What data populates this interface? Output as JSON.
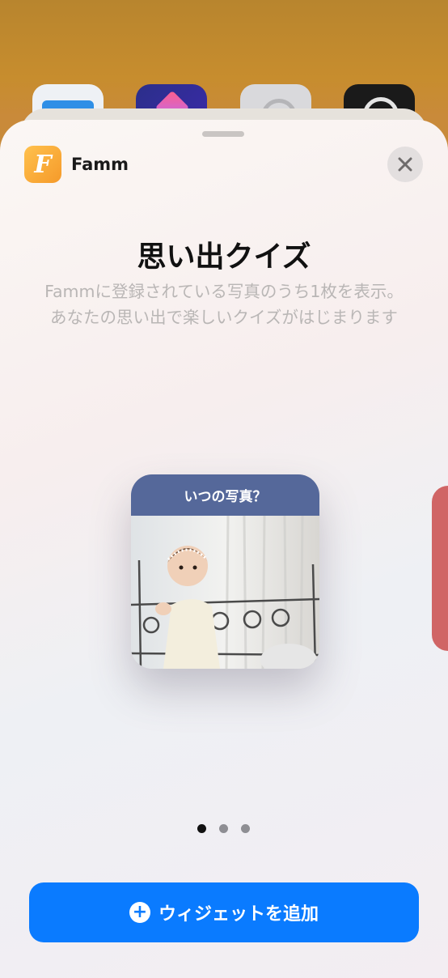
{
  "app": {
    "name": "Famm",
    "icon_letter": "F"
  },
  "widget": {
    "title": "思い出クイズ",
    "description_line1": "Fammに登録されている写真のうち1枚を表示。",
    "description_line2": "あなたの思い出で楽しいクイズがはじまります",
    "preview_header": "いつの写真？"
  },
  "pager": {
    "total": 3,
    "current": 1
  },
  "add_button": {
    "label": "ウィジェットを追加"
  },
  "colors": {
    "accent": "#0a7bff",
    "widget_header": "#55689a",
    "app_icon": "#f7a93a"
  },
  "icons": {
    "close": "close-icon",
    "plus": "plus-circle-icon"
  }
}
